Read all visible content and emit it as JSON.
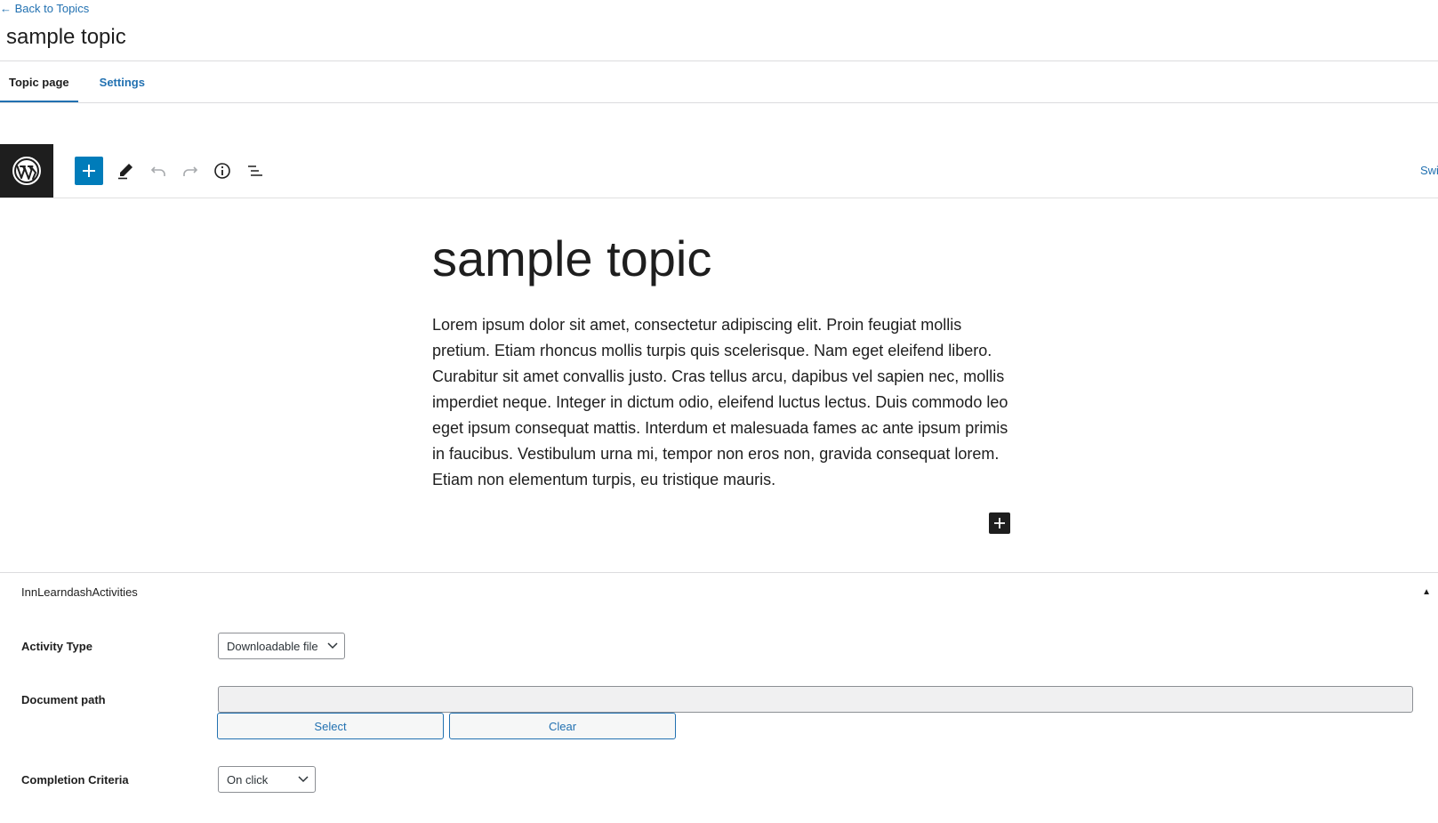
{
  "header": {
    "back_link": "← Back to Topics",
    "title": "sample topic"
  },
  "tabs": [
    {
      "label": "Topic page",
      "active": true
    },
    {
      "label": "Settings",
      "active": false
    }
  ],
  "toolbar": {
    "icons": [
      "wordpress-logo-icon",
      "plus-icon",
      "pencil-icon",
      "undo-icon",
      "redo-icon",
      "info-icon",
      "list-view-icon"
    ],
    "switch_label": "Swi"
  },
  "post": {
    "title": "sample topic",
    "body": "Lorem ipsum dolor sit amet, consectetur adipiscing elit. Proin feugiat mollis pretium. Etiam rhoncus mollis turpis quis scelerisque. Nam eget eleifend libero. Curabitur sit amet convallis justo. Cras tellus arcu, dapibus vel sapien nec, mollis imperdiet neque. Integer in dictum odio, eleifend luctus lectus. Duis commodo leo eget ipsum consequat mattis. Interdum et malesuada fames ac ante ipsum primis in faucibus. Vestibulum urna mi, tempor non eros non, gravida consequat lorem. Etiam non elementum turpis, eu tristique mauris."
  },
  "metabox": {
    "title": "InnLearndashActivities",
    "activity_type": {
      "label": "Activity Type",
      "value": "Downloadable file"
    },
    "document_path": {
      "label": "Document path",
      "value": "",
      "select_label": "Select",
      "clear_label": "Clear"
    },
    "completion_criteria": {
      "label": "Completion Criteria",
      "value": "On click"
    }
  },
  "colors": {
    "accent": "#2271b1",
    "dark": "#1e1e1e",
    "primary_button": "#007cba"
  }
}
